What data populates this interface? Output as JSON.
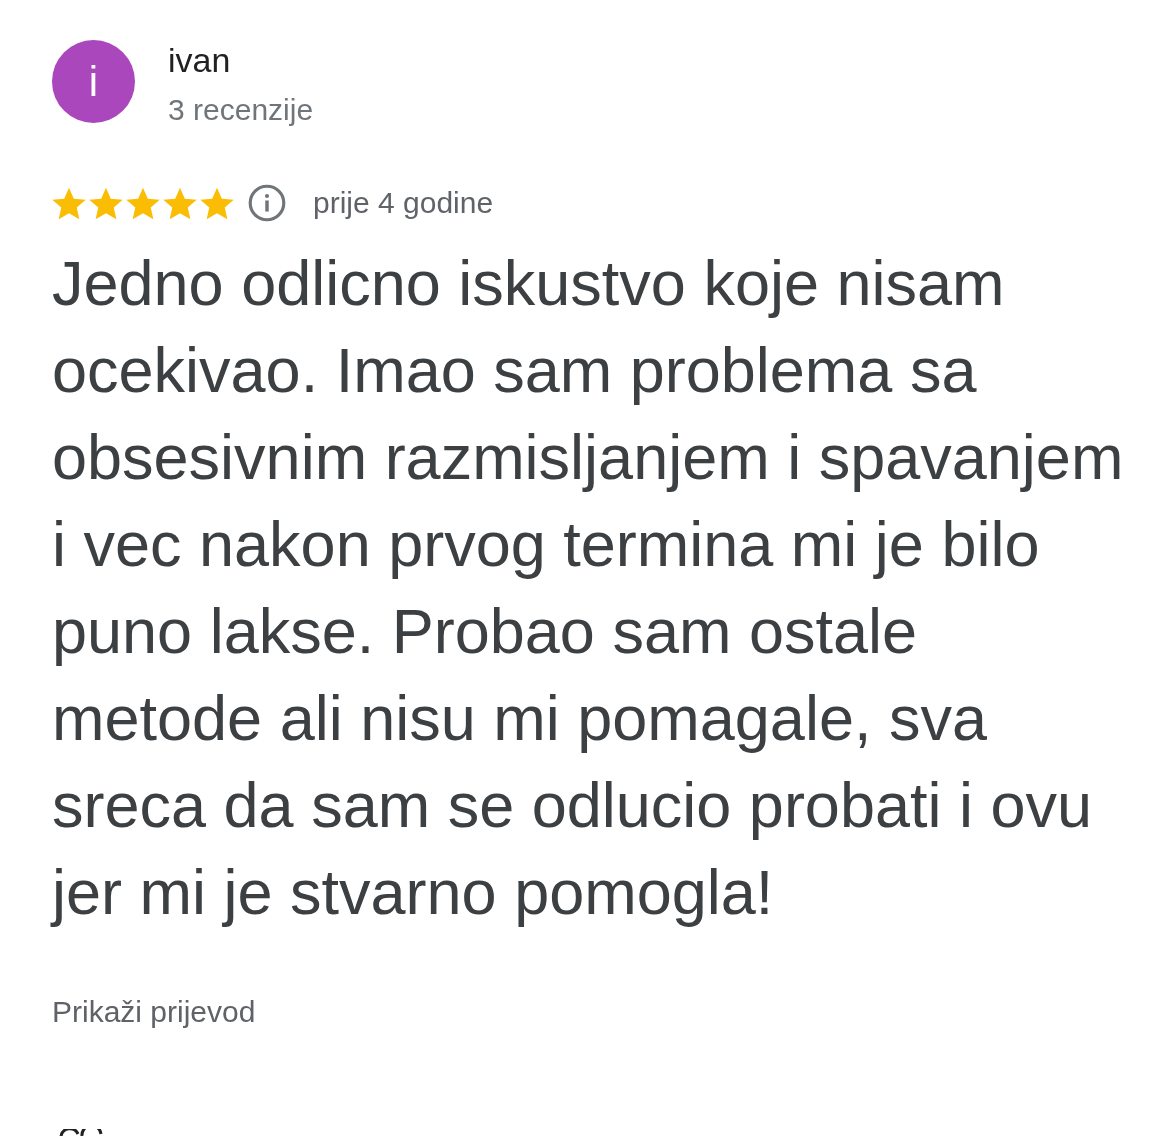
{
  "reviewer": {
    "avatar_letter": "i",
    "name": "ivan",
    "review_count": "3 recenzije"
  },
  "review": {
    "stars": 5,
    "time": "prije 4 godine",
    "text": "Jedno odlicno iskustvo koje nisam ocekivao. Imao sam problema sa obsesivnim razmisljanjem i spavanjem i vec nakon prvog termina mi je bilo puno lakse. Probao sam ostale metode ali nisu mi pomagale, sva sreca da sam se odlucio probati i ovu jer mi je stvarno pomogla!",
    "translate_link": "Prikaži prijevod"
  }
}
